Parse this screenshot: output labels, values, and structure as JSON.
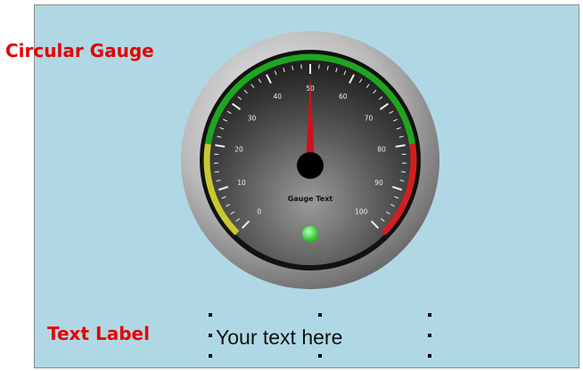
{
  "annotations": {
    "gauge_label": "Circular Gauge",
    "text_label": "Text Label"
  },
  "gauge": {
    "caption": "Gauge Text",
    "value": 50,
    "min": 0,
    "max": 100,
    "tick_labels": [
      "0",
      "10",
      "20",
      "30",
      "40",
      "50",
      "60",
      "70",
      "80",
      "90",
      "100"
    ],
    "ranges": [
      {
        "from": 0,
        "to": 20,
        "color": "#c8c832"
      },
      {
        "from": 20,
        "to": 80,
        "color": "#1fa51f"
      },
      {
        "from": 80,
        "to": 100,
        "color": "#d21e1e"
      }
    ],
    "needle_color": "#d01020",
    "indicator_color": "#3ee83e"
  },
  "text_widget": {
    "value": "Your text here"
  }
}
